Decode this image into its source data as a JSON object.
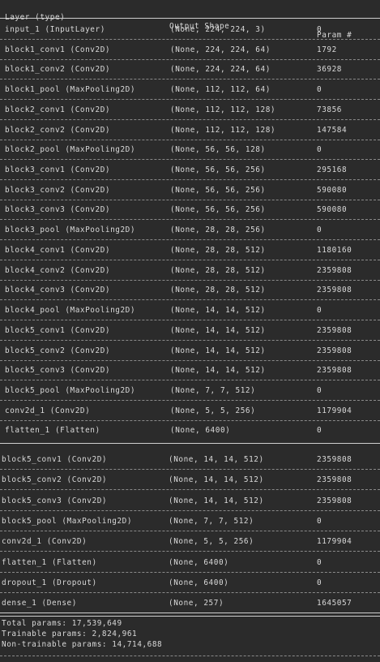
{
  "header": {
    "layer": "Layer (type)",
    "output": "Output Shape",
    "param": "Param #"
  },
  "table1": [
    {
      "layer": "input_1 (InputLayer)",
      "output": "(None, 224, 224, 3)",
      "param": "0"
    },
    {
      "layer": "block1_conv1 (Conv2D)",
      "output": "(None, 224, 224, 64)",
      "param": "1792"
    },
    {
      "layer": "block1_conv2 (Conv2D)",
      "output": "(None, 224, 224, 64)",
      "param": "36928"
    },
    {
      "layer": "block1_pool (MaxPooling2D)",
      "output": "(None, 112, 112, 64)",
      "param": "0"
    },
    {
      "layer": "block2_conv1 (Conv2D)",
      "output": "(None, 112, 112, 128)",
      "param": "73856"
    },
    {
      "layer": "block2_conv2 (Conv2D)",
      "output": "(None, 112, 112, 128)",
      "param": "147584"
    },
    {
      "layer": "block2_pool (MaxPooling2D)",
      "output": "(None, 56, 56, 128)",
      "param": "0"
    },
    {
      "layer": "block3_conv1 (Conv2D)",
      "output": "(None, 56, 56, 256)",
      "param": "295168"
    },
    {
      "layer": "block3_conv2 (Conv2D)",
      "output": "(None, 56, 56, 256)",
      "param": "590080"
    },
    {
      "layer": "block3_conv3 (Conv2D)",
      "output": "(None, 56, 56, 256)",
      "param": "590080"
    },
    {
      "layer": "block3_pool (MaxPooling2D)",
      "output": "(None, 28, 28, 256)",
      "param": "0"
    },
    {
      "layer": "block4_conv1 (Conv2D)",
      "output": "(None, 28, 28, 512)",
      "param": "1180160"
    },
    {
      "layer": "block4_conv2 (Conv2D)",
      "output": "(None, 28, 28, 512)",
      "param": "2359808"
    },
    {
      "layer": "block4_conv3 (Conv2D)",
      "output": "(None, 28, 28, 512)",
      "param": "2359808"
    },
    {
      "layer": "block4_pool (MaxPooling2D)",
      "output": "(None, 14, 14, 512)",
      "param": "0"
    },
    {
      "layer": "block5_conv1 (Conv2D)",
      "output": "(None, 14, 14, 512)",
      "param": "2359808"
    },
    {
      "layer": "block5_conv2 (Conv2D)",
      "output": "(None, 14, 14, 512)",
      "param": "2359808"
    },
    {
      "layer": "block5_conv3 (Conv2D)",
      "output": "(None, 14, 14, 512)",
      "param": "2359808"
    },
    {
      "layer": "block5_pool (MaxPooling2D)",
      "output": "(None, 7, 7, 512)",
      "param": "0"
    },
    {
      "layer": "conv2d_1 (Conv2D)",
      "output": "(None, 5, 5, 256)",
      "param": "1179904"
    },
    {
      "layer": "flatten_1 (Flatten)",
      "output": "(None, 6400)",
      "param": "0"
    }
  ],
  "table2": [
    {
      "layer": "block5_conv1 (Conv2D)",
      "output": "(None, 14, 14, 512)",
      "param": "2359808"
    },
    {
      "layer": "block5_conv2 (Conv2D)",
      "output": "(None, 14, 14, 512)",
      "param": "2359808"
    },
    {
      "layer": "block5_conv3 (Conv2D)",
      "output": "(None, 14, 14, 512)",
      "param": "2359808"
    },
    {
      "layer": "block5_pool (MaxPooling2D)",
      "output": "(None, 7, 7, 512)",
      "param": "0"
    },
    {
      "layer": "conv2d_1 (Conv2D)",
      "output": "(None, 5, 5, 256)",
      "param": "1179904"
    },
    {
      "layer": "flatten_1 (Flatten)",
      "output": "(None, 6400)",
      "param": "0"
    },
    {
      "layer": "dropout_1 (Dropout)",
      "output": "(None, 6400)",
      "param": "0"
    },
    {
      "layer": "dense_1 (Dense)",
      "output": "(None, 257)",
      "param": "1645057"
    }
  ],
  "summary": {
    "total": "Total params: 17,539,649",
    "trainable": "Trainable params: 2,824,961",
    "non_trainable": "Non-trainable params: 14,714,688"
  }
}
